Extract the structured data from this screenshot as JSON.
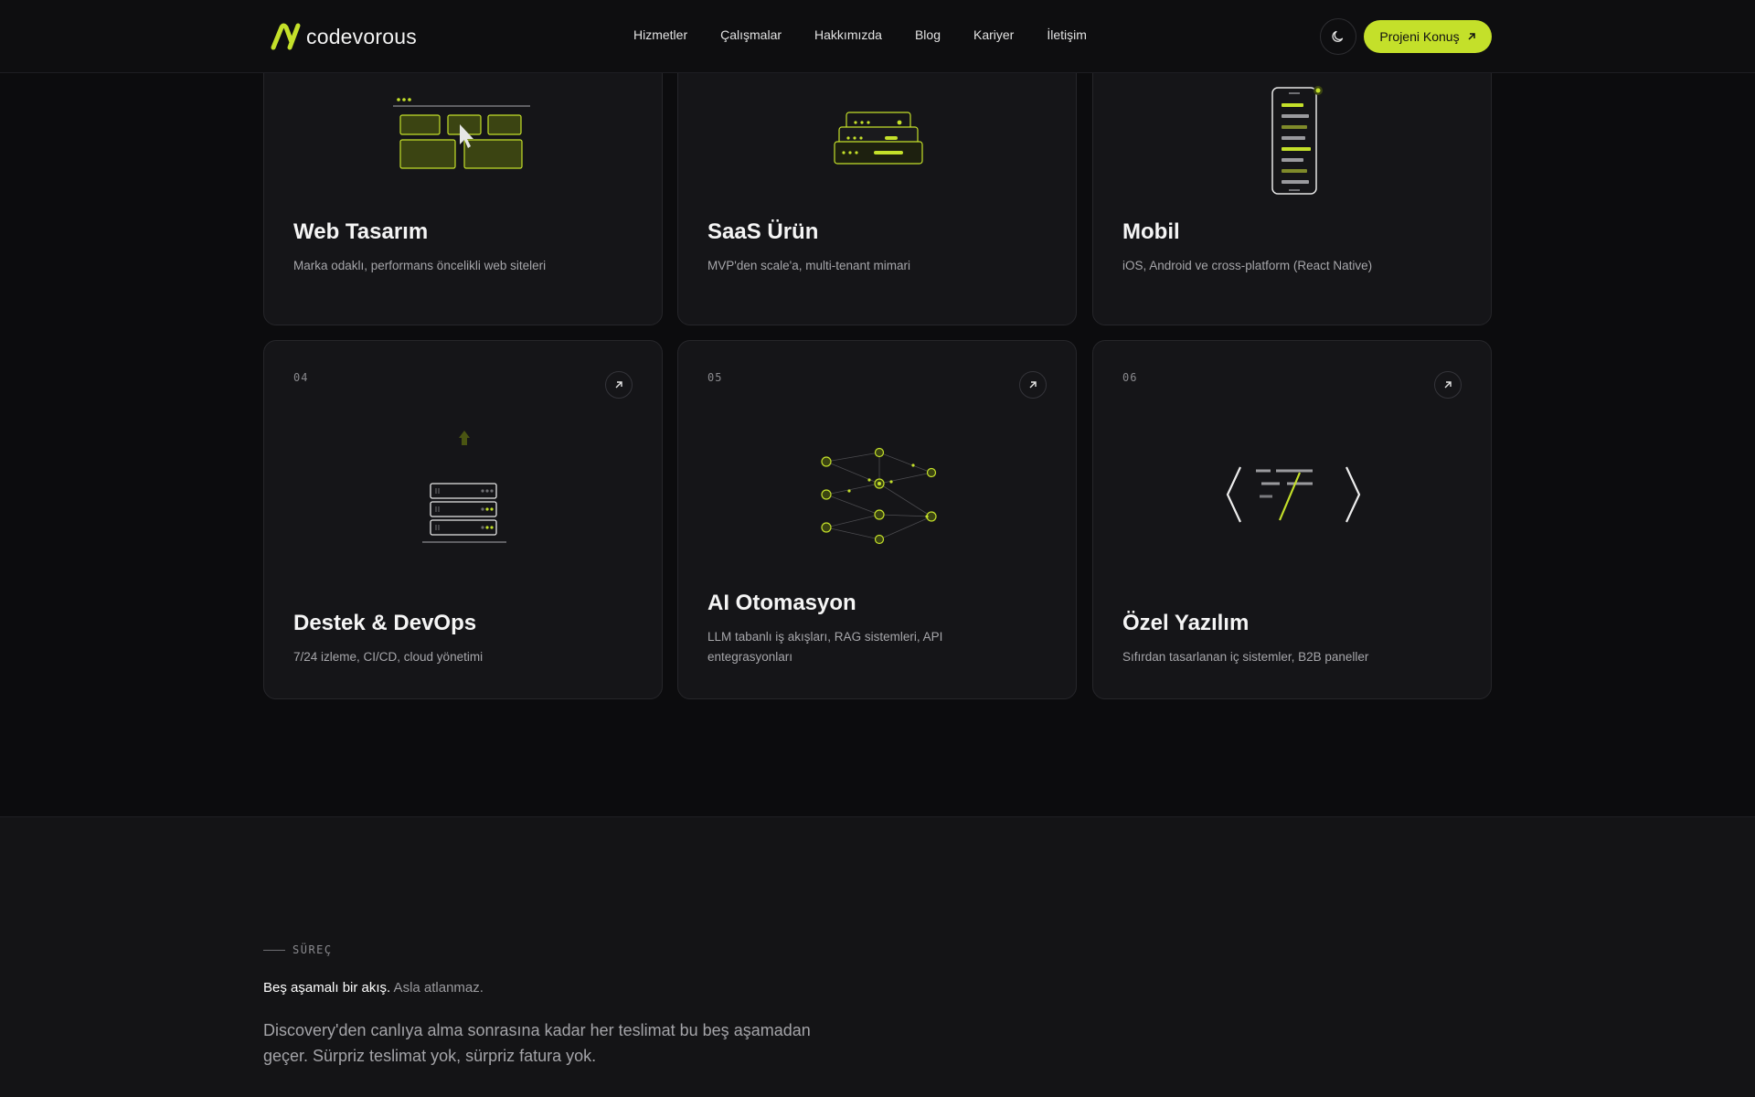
{
  "brand": {
    "name": "codevorous",
    "accent": "#c4e02a"
  },
  "nav": {
    "items": [
      "Hizmetler",
      "Çalışmalar",
      "Hakkımızda",
      "Blog",
      "Kariyer",
      "İletişim"
    ]
  },
  "header": {
    "theme_icon": "moon-icon",
    "cta_label": "Projeni Konuş"
  },
  "services": [
    {
      "num": "",
      "title": "Web Tasarım",
      "desc": "Marka odaklı, performans öncelikli web siteleri",
      "icon": "web-layout-illustration"
    },
    {
      "num": "",
      "title": "SaaS Ürün",
      "desc": "MVP'den scale'a, multi-tenant mimari",
      "icon": "stacked-layers-illustration"
    },
    {
      "num": "",
      "title": "Mobil",
      "desc": "iOS, Android ve cross-platform (React Native)",
      "icon": "phone-illustration"
    },
    {
      "num": "04",
      "title": "Destek & DevOps",
      "desc": "7/24 izleme, CI/CD, cloud yönetimi",
      "icon": "server-stack-illustration"
    },
    {
      "num": "05",
      "title": "AI Otomasyon",
      "desc": "LLM tabanlı iş akışları, RAG sistemleri, API entegrasyonları",
      "icon": "neural-network-illustration"
    },
    {
      "num": "06",
      "title": "Özel Yazılım",
      "desc": "Sıfırdan tasarlanan iç sistemler, B2B paneller",
      "icon": "code-brackets-illustration"
    }
  ],
  "process": {
    "eyebrow": "SÜREÇ",
    "headline_strong": "Beş aşamalı bir akış.",
    "headline_soft": " Asla atlanmaz.",
    "lead": "Discovery'den canlıya alma sonrasına kadar her teslimat bu beş aşamadan geçer. Sürpriz teslimat yok, sürpriz fatura yok."
  }
}
